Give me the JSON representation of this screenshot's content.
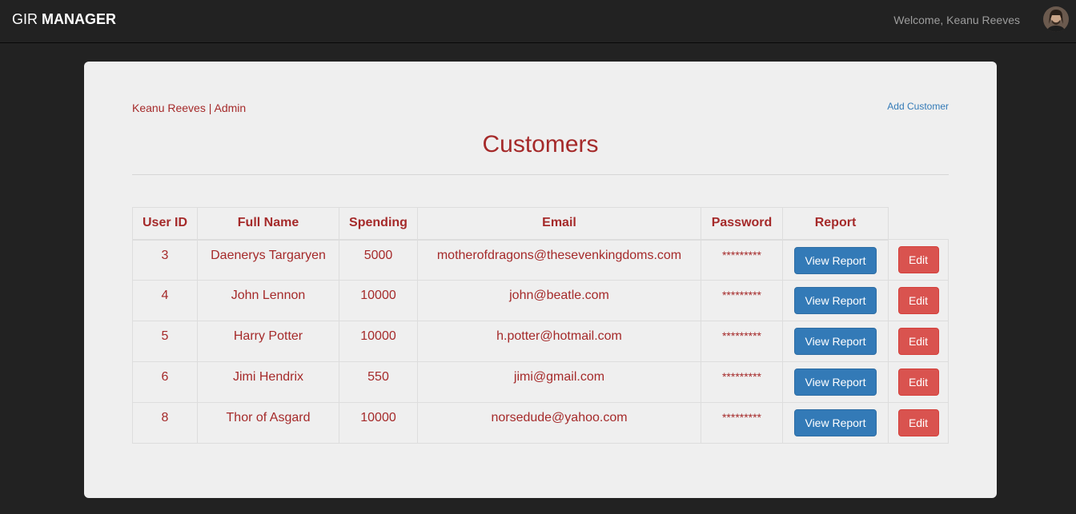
{
  "nav": {
    "brand_light": "GIR ",
    "brand_bold": "MANAGER",
    "welcome": "Welcome, Keanu Reeves"
  },
  "panel": {
    "user_line": "Keanu Reeves | Admin",
    "add_customer": "Add Customer",
    "title": "Customers"
  },
  "table": {
    "headers": [
      "User ID",
      "Full Name",
      "Spending",
      "Email",
      "Password",
      "Report"
    ],
    "rows": [
      {
        "id": "3",
        "name": "Daenerys Targaryen",
        "spending": "5000",
        "email": "motherofdragons@thesevenkingdoms.com",
        "password": "*********",
        "report": "View Report",
        "edit": "Edit"
      },
      {
        "id": "4",
        "name": "John Lennon",
        "spending": "10000",
        "email": "john@beatle.com",
        "password": "*********",
        "report": "View Report",
        "edit": "Edit"
      },
      {
        "id": "5",
        "name": "Harry Potter",
        "spending": "10000",
        "email": "h.potter@hotmail.com",
        "password": "*********",
        "report": "View Report",
        "edit": "Edit"
      },
      {
        "id": "6",
        "name": "Jimi Hendrix",
        "spending": "550",
        "email": "jimi@gmail.com",
        "password": "*********",
        "report": "View Report",
        "edit": "Edit"
      },
      {
        "id": "8",
        "name": "Thor of Asgard",
        "spending": "10000",
        "email": "norsedude@yahoo.com",
        "password": "*********",
        "report": "View Report",
        "edit": "Edit"
      }
    ]
  },
  "colors": {
    "accent": "#a52a2a",
    "primary": "#337ab7",
    "danger": "#d9534f",
    "navbar": "#222222",
    "panel": "#efefef"
  },
  "icons": {
    "avatar": "user-avatar-photo"
  }
}
